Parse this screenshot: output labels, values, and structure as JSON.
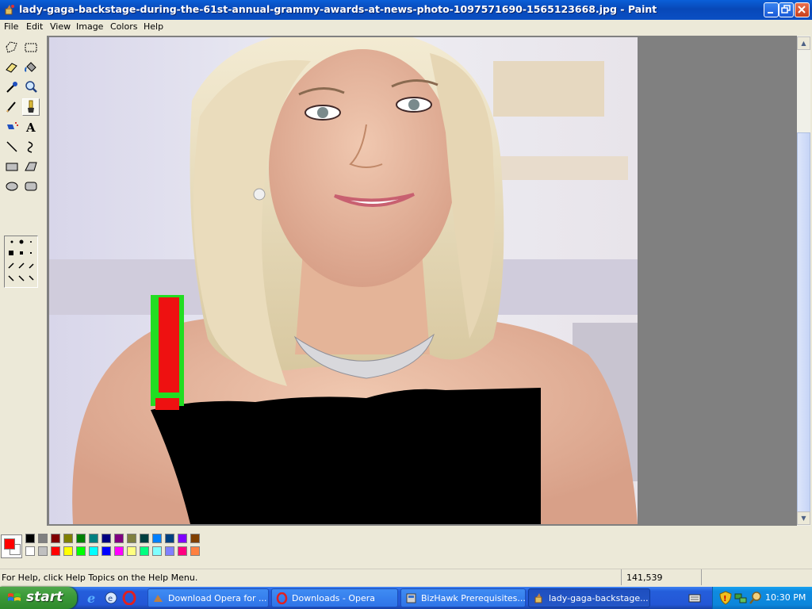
{
  "window": {
    "title": "lady-gaga-backstage-during-the-61st-annual-grammy-awards-at-news-photo-1097571690-1565123668.jpg - Paint"
  },
  "menu": [
    "File",
    "Edit",
    "View",
    "Image",
    "Colors",
    "Help"
  ],
  "tools": [
    {
      "name": "free-form-select",
      "icon": "free-select-icon"
    },
    {
      "name": "select",
      "icon": "rect-select-icon"
    },
    {
      "name": "eraser",
      "icon": "eraser-icon"
    },
    {
      "name": "fill-with-color",
      "icon": "paint-bucket-icon"
    },
    {
      "name": "pick-color",
      "icon": "eyedropper-icon"
    },
    {
      "name": "magnifier",
      "icon": "magnifier-icon"
    },
    {
      "name": "pencil",
      "icon": "pencil-icon"
    },
    {
      "name": "brush",
      "icon": "brush-icon",
      "selected": true
    },
    {
      "name": "airbrush",
      "icon": "airbrush-icon"
    },
    {
      "name": "text",
      "icon": "text-icon"
    },
    {
      "name": "line",
      "icon": "line-icon"
    },
    {
      "name": "curve",
      "icon": "curve-icon"
    },
    {
      "name": "rectangle",
      "icon": "rectangle-icon"
    },
    {
      "name": "polygon",
      "icon": "polygon-icon"
    },
    {
      "name": "ellipse",
      "icon": "ellipse-icon"
    },
    {
      "name": "rounded-rectangle",
      "icon": "rounded-rect-icon"
    }
  ],
  "colors": {
    "primary": "#ff0000",
    "secondary": "#ffffff",
    "palette_top": [
      "#000000",
      "#808080",
      "#800000",
      "#808000",
      "#008000",
      "#008080",
      "#000080",
      "#800080",
      "#808040",
      "#004040",
      "#0080ff",
      "#004080",
      "#8000ff",
      "#804000"
    ],
    "palette_bottom": [
      "#ffffff",
      "#c0c0c0",
      "#ff0000",
      "#ffff00",
      "#00ff00",
      "#00ffff",
      "#0000ff",
      "#ff00ff",
      "#ffff80",
      "#00ff80",
      "#80ffff",
      "#8080ff",
      "#ff0080",
      "#ff8040"
    ]
  },
  "status": {
    "help": "For Help, click Help Topics on the Help Menu.",
    "coords": "141,539"
  },
  "taskbar": {
    "start": "start",
    "tasks": [
      {
        "label": "Download Opera for ...",
        "icon": "opera-icon"
      },
      {
        "label": "Downloads - Opera",
        "icon": "opera-icon"
      },
      {
        "label": "BizHawk Prerequisites...",
        "icon": "installer-icon"
      },
      {
        "label": "lady-gaga-backstage...",
        "icon": "paint-icon",
        "active": true
      }
    ],
    "clock": "10:30 PM"
  }
}
